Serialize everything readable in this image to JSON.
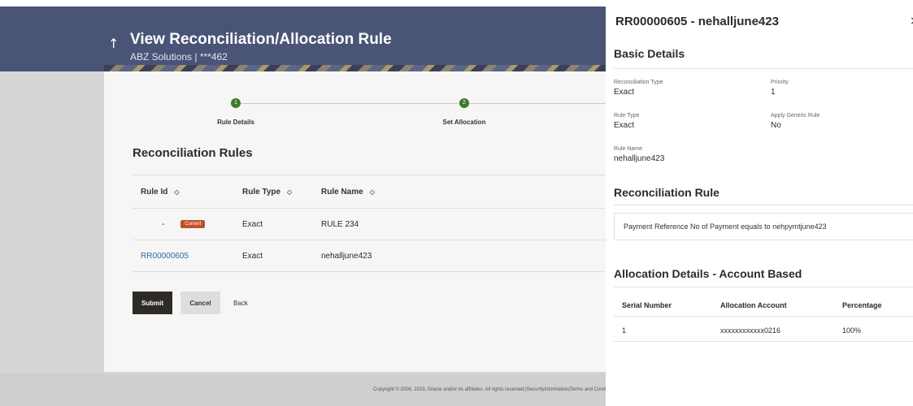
{
  "header": {
    "title": "View Reconciliation/Allocation Rule",
    "subtitle": "ABZ Solutions | ***462"
  },
  "stepper": {
    "steps": [
      {
        "number": "1",
        "label": "Rule Details"
      },
      {
        "number": "2",
        "label": "Set Allocation"
      }
    ]
  },
  "main": {
    "section_title": "Reconciliation Rules",
    "table": {
      "columns": [
        "Rule Id",
        "Rule Type",
        "Rule Name"
      ],
      "rows": [
        {
          "rule_id": "-",
          "badge": "Current",
          "rule_type": "Exact",
          "rule_name": "RULE 234"
        },
        {
          "rule_id": "RR00000605",
          "badge": "",
          "rule_type": "Exact",
          "rule_name": "nehalljune423"
        }
      ]
    },
    "buttons": {
      "submit": "Submit",
      "cancel": "Cancel",
      "back": "Back"
    }
  },
  "footer": {
    "text": "Copyright © 2006, 2023, Oracle and/or its affiliates. All rights reserved.|SecurityInformation|Terms and Cond"
  },
  "panel": {
    "title": "RR00000605 - nehalljune423",
    "close_symbol": "×",
    "basic_details": {
      "heading": "Basic Details",
      "fields": [
        {
          "label": "Reconciliation Type",
          "value": "Exact"
        },
        {
          "label": "Priority",
          "value": "1"
        },
        {
          "label": "Rule Type",
          "value": "Exact"
        },
        {
          "label": "Apply Generic Rule",
          "value": "No"
        },
        {
          "label": "Rule Name",
          "value": "nehalljune423"
        }
      ]
    },
    "reconciliation_rule": {
      "heading": "Reconciliation Rule",
      "text": "Payment Reference No of Payment equals to nehpymtjune423"
    },
    "allocation": {
      "heading": "Allocation Details - Account Based",
      "columns": [
        "Serial Number",
        "Allocation Account",
        "Percentage"
      ],
      "rows": [
        {
          "serial": "1",
          "account": "xxxxxxxxxxxx0216",
          "percentage": "100%"
        }
      ]
    }
  }
}
